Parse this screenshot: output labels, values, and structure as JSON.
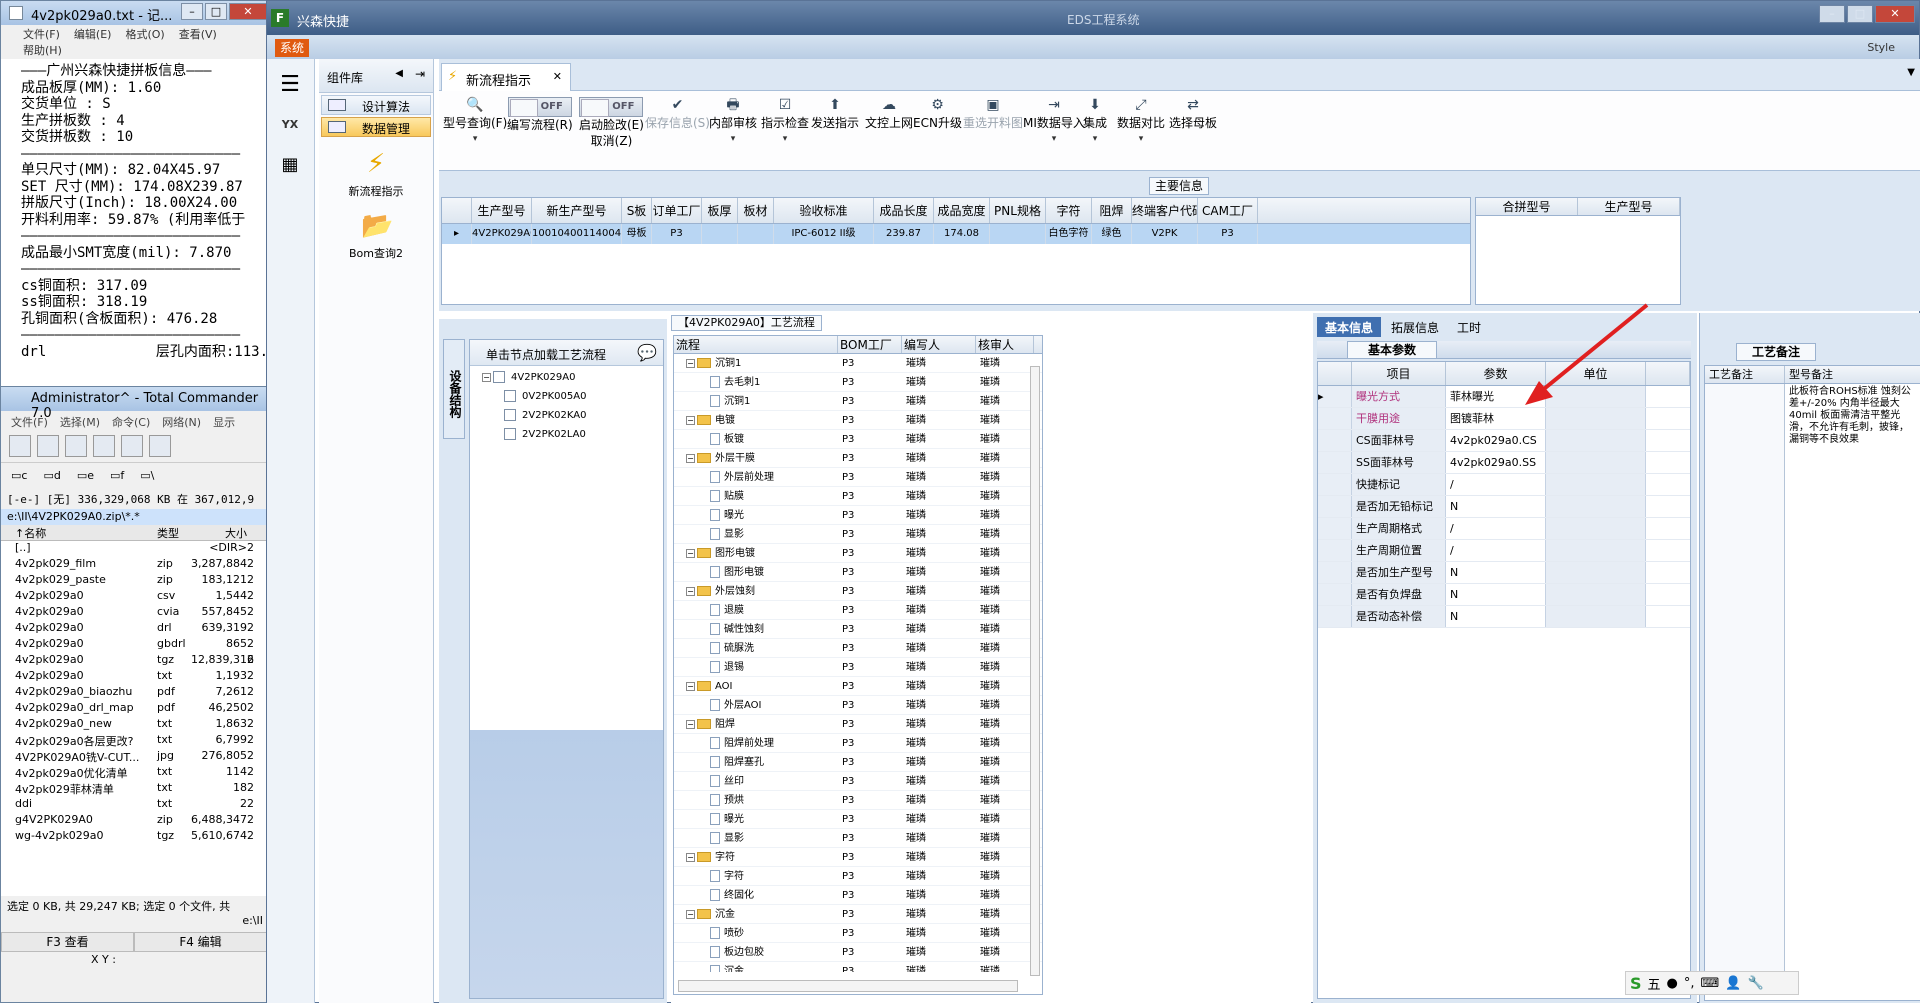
{
  "notepad": {
    "title": "4v2pk029a0.txt - 记...",
    "menu": [
      "文件(F)",
      "编辑(E)",
      "格式(O)",
      "查看(V)",
      "帮助(H)"
    ],
    "lines": [
      "———广州兴森快捷拼板信息———",
      "成品板厚(MM): 1.60",
      "交货单位 : S",
      "生产拼板数 : 4",
      "交货拼板数 : 10",
      "——————————————————————————",
      "单只尺寸(MM): 82.04X45.97",
      "SET 尺寸(MM): 174.08X239.87",
      "拼版尺寸(Inch): 18.00X24.00",
      "开料利用率: 59.87% (利用率低于",
      "——————————————————————————",
      "成品最小SMT宽度(mil): 7.870",
      "——————————————————————————",
      "cs铜面积: 317.09",
      "ss铜面积: 318.19",
      "孔铜面积(含板面积): 476.28",
      "",
      "——————————————————————————",
      "drl             层孔内面积:113."
    ]
  },
  "tc": {
    "title": "Administrator^ - Total Commander 7.0",
    "menu": [
      "文件(F)",
      "选择(M)",
      "命令(C)",
      "网络(N)",
      "显示"
    ],
    "drives": [
      "c",
      "d",
      "e",
      "f",
      "\\"
    ],
    "free": "[-e-] [无] 336,329,068 KB 在 367,012,9",
    "path": "e:\\II\\4V2PK029A0.zip\\*.*",
    "cols": [
      "↑名称",
      "类型",
      "大小",
      ""
    ],
    "rows": [
      [
        "[..]",
        "",
        "<DIR>",
        "2"
      ],
      [
        "4v2pk029_film",
        "zip",
        "3,287,884",
        "2"
      ],
      [
        "4v2pk029_paste",
        "zip",
        "183,121",
        "2"
      ],
      [
        "4v2pk029a0",
        "csv",
        "1,544",
        "2"
      ],
      [
        "4v2pk029a0",
        "cvia",
        "557,845",
        "2"
      ],
      [
        "4v2pk029a0",
        "drl",
        "639,319",
        "2"
      ],
      [
        "4v2pk029a0",
        "gbdrl",
        "865",
        "2"
      ],
      [
        "4v2pk029a0",
        "tgz",
        "12,839,316",
        "2"
      ],
      [
        "4v2pk029a0",
        "txt",
        "1,193",
        "2"
      ],
      [
        "4v2pk029a0_biaozhu",
        "pdf",
        "7,261",
        "2"
      ],
      [
        "4v2pk029a0_drl_map",
        "pdf",
        "46,250",
        "2"
      ],
      [
        "4v2pk029a0_new",
        "txt",
        "1,863",
        "2"
      ],
      [
        "4v2pk029a0各层更改?",
        "txt",
        "6,799",
        "2"
      ],
      [
        "4V2PK029A0铣V-CUT...",
        "jpg",
        "276,805",
        "2"
      ],
      [
        "4v2pk029a0优化清单",
        "txt",
        "114",
        "2"
      ],
      [
        "4v2pk029菲林清单",
        "txt",
        "18",
        "2"
      ],
      [
        "ddi",
        "txt",
        "2",
        "2"
      ],
      [
        "g4V2PK029A0",
        "zip",
        "6,488,347",
        "2"
      ],
      [
        "wg-4v2pk029a0",
        "tgz",
        "5,610,674",
        "2"
      ]
    ],
    "status": "选定 0 KB, 共 29,247 KB; 选定 0 个文件, 共",
    "cmdline": "e:\\II",
    "fkeys": [
      "F3 查看",
      "F4 编辑"
    ],
    "xy": "X Y :"
  },
  "app": {
    "title": "兴森快捷",
    "center_title": "EDS工程系统",
    "sys": "系统",
    "style": "Style",
    "complib_title": "组件库",
    "complib_items": [
      "设计算法",
      "数据管理"
    ],
    "tools": [
      "新流程指示",
      "Bom查询2"
    ],
    "doc_tab": "新流程指示",
    "ribbon": [
      {
        "label": "型号查询(F)",
        "dd": "▾",
        "icon": "🔍"
      },
      {
        "label": "编写流程(R)",
        "toggle": "OFF"
      },
      {
        "label": "启动脸改(E)",
        "label2": "取消(Z)",
        "toggle": "OFF"
      },
      {
        "label": "保存信息(S)",
        "icon": "✔",
        "dis": true
      },
      {
        "label": "内部审核",
        "dd": "▾",
        "icon": "🖶"
      },
      {
        "label": "指示检查",
        "dd": "▾",
        "icon": "☑"
      },
      {
        "label": "发送指示",
        "icon": "⬆"
      },
      {
        "label": "文控上网",
        "icon": "☁"
      },
      {
        "label": "ECN升级",
        "icon": "⚙"
      },
      {
        "label": "重选开料图",
        "icon": "▣",
        "dis": true
      },
      {
        "label": "MI数据导入",
        "dd": "▾",
        "icon": "⇥"
      },
      {
        "label": "集成",
        "dd": "▾",
        "icon": "⬇"
      },
      {
        "label": "数据对比",
        "dd": "▾",
        "icon": "⤢"
      },
      {
        "label": "选择母板",
        "icon": "⇄"
      }
    ],
    "main_info_label": "主要信息",
    "main_cols": [
      "生产型号",
      "新生产型号",
      "S板",
      "订单工厂",
      "板厚",
      "板材",
      "验收标准",
      "成品长度",
      "成品宽度",
      "PNL规格",
      "字符",
      "阻焊",
      "终端客户代码",
      "CAM工厂"
    ],
    "main_row": [
      "4V2PK029A0",
      "10010400114004",
      "母板",
      "P3",
      "",
      "",
      "IPC-6012 II级",
      "239.87",
      "174.08",
      "",
      "白色字符",
      "绿色",
      "V2PK",
      "P3"
    ],
    "merge_cols": [
      "合拼型号",
      "生产型号"
    ],
    "tree_side": "设备结构",
    "tree_head": "单击节点加载工艺流程",
    "tree_nodes": [
      "4V2PK029A0",
      "0V2PK005A0",
      "2V2PK02KA0",
      "2V2PK02LA0"
    ],
    "flow_caption": "【4V2PK029A0】工艺流程",
    "flow_cols": [
      "流程",
      "BOM工厂",
      "编写人",
      "核审人"
    ],
    "flow_rows": [
      [
        "g",
        "沉铜1"
      ],
      [
        "d",
        "去毛刺1"
      ],
      [
        "d",
        "沉铜1"
      ],
      [
        "g",
        "电镀"
      ],
      [
        "d",
        "板镀"
      ],
      [
        "g",
        "外层干膜"
      ],
      [
        "d",
        "外层前处理"
      ],
      [
        "d",
        "贴膜"
      ],
      [
        "d",
        "曝光"
      ],
      [
        "d",
        "显影"
      ],
      [
        "g",
        "图形电镀"
      ],
      [
        "d",
        "图形电镀"
      ],
      [
        "g",
        "外层蚀刻"
      ],
      [
        "d",
        "退膜"
      ],
      [
        "d",
        "碱性蚀刻"
      ],
      [
        "d",
        "硫脲洗"
      ],
      [
        "d",
        "退锡"
      ],
      [
        "g",
        "AOI"
      ],
      [
        "d",
        "外层AOI"
      ],
      [
        "g",
        "阻焊"
      ],
      [
        "d",
        "阻焊前处理"
      ],
      [
        "d",
        "阻焊塞孔"
      ],
      [
        "d",
        "丝印"
      ],
      [
        "d",
        "预烘"
      ],
      [
        "d",
        "曝光"
      ],
      [
        "d",
        "显影"
      ],
      [
        "g",
        "字符"
      ],
      [
        "d",
        "字符"
      ],
      [
        "d",
        "终固化"
      ],
      [
        "g",
        "沉金"
      ],
      [
        "d",
        "喷砂"
      ],
      [
        "d",
        "板边包胶"
      ],
      [
        "d",
        "沉金"
      ]
    ],
    "flow_factory": "P3",
    "flow_person": "璀璘",
    "param_tabs": [
      "基本信息",
      "拓展信息",
      "工时"
    ],
    "param_sub": "基本参数",
    "param_cols": [
      "项目",
      "参数",
      "单位"
    ],
    "params": [
      [
        "曝光方式",
        "菲林曝光",
        "#b0307c"
      ],
      [
        "干膜用途",
        "图镀菲林",
        "#b0307c"
      ],
      [
        "CS面菲林号",
        "4v2pk029a0.CS",
        ""
      ],
      [
        "SS面菲林号",
        "4v2pk029a0.SS",
        ""
      ],
      [
        "快捷标记",
        "/",
        ""
      ],
      [
        "是否加无铅标记",
        "N",
        ""
      ],
      [
        "生产周期格式",
        "/",
        ""
      ],
      [
        "生产周期位置",
        "/",
        ""
      ],
      [
        "是否加生产型号",
        "N",
        ""
      ],
      [
        "是否有负焊盘",
        "N",
        ""
      ],
      [
        "是否动态补偿",
        "N",
        ""
      ]
    ],
    "notes_tab": "工艺备注",
    "notes_cols": [
      "工艺备注",
      "型号备注"
    ],
    "notes_text": "此板符合ROHS标准  蚀刻公差+/-20%  内角半径最大40mil  板面需清洁平整光滑，不允许有毛刺，披锋，漏铜等不良效果",
    "ime": "五"
  },
  "colors": {
    "accent": "#3f6fb0",
    "arrow": "#e02020",
    "selected_row": "#b9d6f3"
  }
}
